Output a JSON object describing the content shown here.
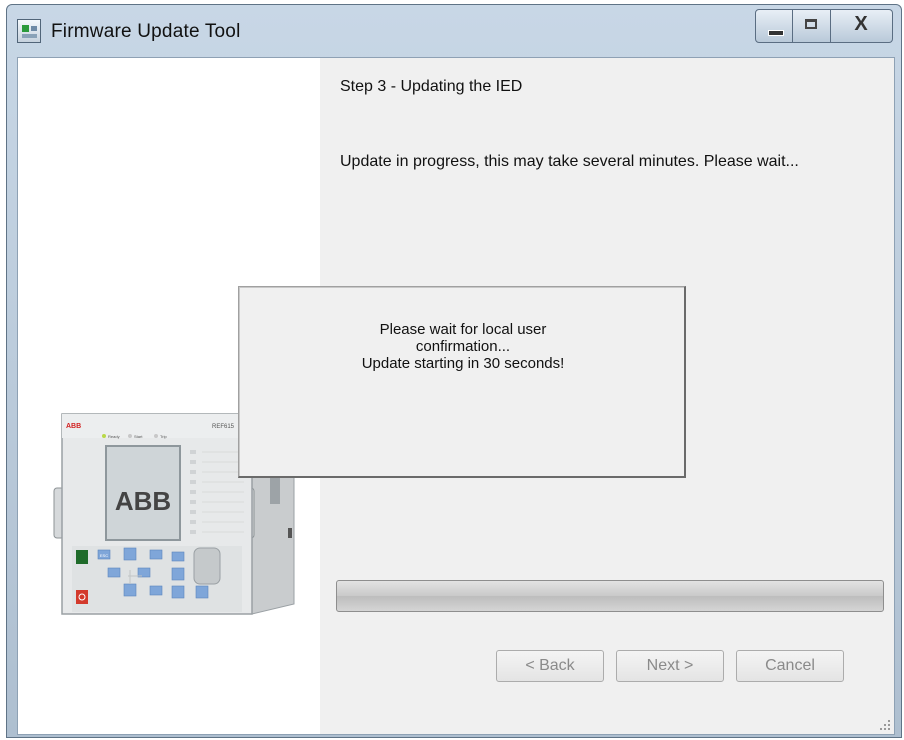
{
  "window": {
    "title": "Firmware Update Tool",
    "accent_color": "#c8d7e6"
  },
  "controls": {
    "minimize_icon": "minimize-icon",
    "maximize_icon": "maximize-icon",
    "close_icon": "close-icon",
    "close_glyph": "X"
  },
  "step": {
    "title": "Step 3 - Updating the IED",
    "message": "Update in progress, this may take several minutes. Please wait..."
  },
  "device": {
    "brand_small": "ABB",
    "model": "REF615",
    "screen_logo": "ABB",
    "led_labels": [
      "Ready",
      "Start",
      "Trip"
    ],
    "key_label": "ESC"
  },
  "modal": {
    "lines": [
      "Please wait for local user",
      "confirmation...",
      "Update starting in 30 seconds!"
    ]
  },
  "progress": {
    "value": 0
  },
  "buttons": {
    "back": "< Back",
    "next": "Next >",
    "cancel": "Cancel"
  }
}
